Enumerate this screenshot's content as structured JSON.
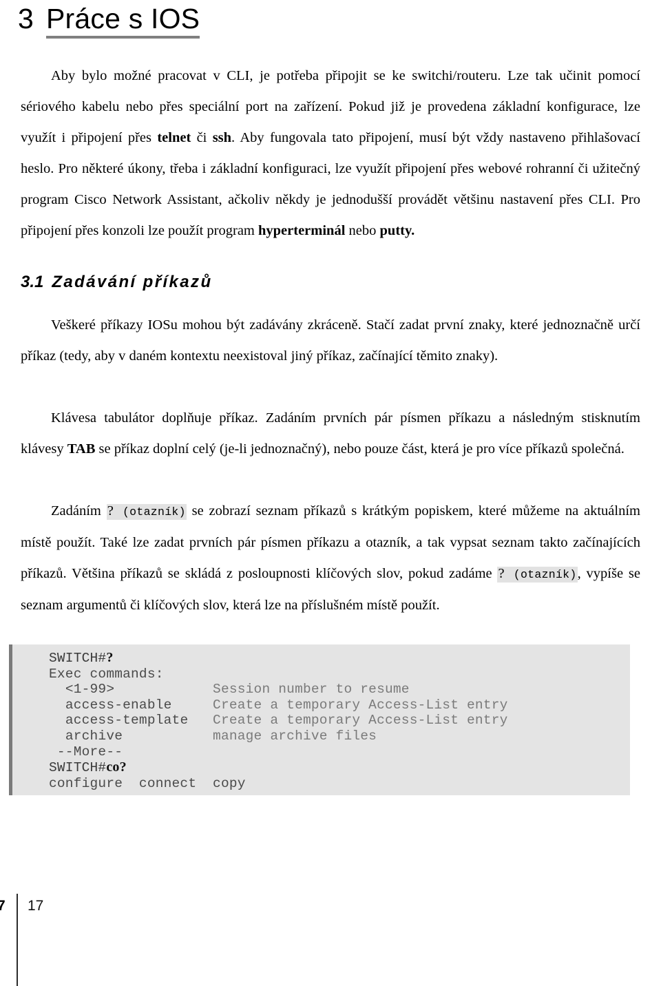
{
  "page": {
    "title_number": "3",
    "title_text": "Práce s IOS",
    "underline_color": "#808080",
    "background_color": "#ffffff"
  },
  "section": {
    "number": "3.1",
    "heading": "Zadávání příkazů"
  },
  "paragraphs": {
    "p1_a": "Aby bylo možné pracovat v CLI, je potřeba připojit se ke switchi/routeru. Lze tak učinit pomocí  sériového kabelu nebo přes speciální port na zařízení. Pokud již je provedena základní konfigurace, lze využít i připojení přes ",
    "p1_bold1": "telnet",
    "p1_b": " či ",
    "p1_bold2": "ssh",
    "p1_c": ". Aby fungovala tato připojení, musí být vždy nastaveno přihlašovací heslo. Pro některé úkony, třeba i základní konfiguraci, lze využít připojení přes webové rohranní či užitečný program Cisco Network Assistant, ačkoliv někdy je jednodušší provádět většinu nastavení přes CLI. Pro připojení přes konzoli lze použít program ",
    "p1_bold3": "hyperterminál",
    "p1_d": " nebo ",
    "p1_bold4": "putty.",
    "p2": "Veškeré příkazy IOSu mohou být zadávány zkráceně. Stačí zadat první znaky, které jednoznačně určí příkaz (tedy, aby v daném kontextu neexistoval jiný příkaz, začínající těmito znaky).",
    "p3_a": "Klávesa tabulátor doplňuje příkaz. Zadáním prvních pár písmen příkazu a následným stisknutím klávesy ",
    "p3_bold": "TAB",
    "p3_b": " se příkaz doplní celý (je-li jednoznačný), nebo pouze část, která je pro více příkazů společná.",
    "p4_a": "Zadáním ",
    "p4_code1_q": "?",
    "p4_code1_t": " (otazník)",
    "p4_b": " se zobrazí seznam příkazů s krátkým popiskem, které můžeme na aktuálním místě použít. Také lze zadat prvních pár písmen příkazu a otazník, a tak vypsat seznam takto začínajících příkazů. Většina příkazů se skládá z posloupnosti klíčových slov, pokud zadáme ",
    "p4_code2_q": "?",
    "p4_code2_t": " (otazník)",
    "p4_c": ", vypíše se seznam argumentů či klíčových slov, která lze na příslušném místě použít."
  },
  "code_block": {
    "background_color": "#e4e4e4",
    "accent_color": "#7a7a7a",
    "lines": [
      {
        "indent": "",
        "prompt": "SWITCH#",
        "bold": "?",
        "cmd": "",
        "desc": ""
      },
      {
        "indent": "",
        "prompt": "",
        "bold": "",
        "cmd": "Exec commands:",
        "desc": ""
      },
      {
        "indent": "  ",
        "prompt": "",
        "bold": "",
        "cmd": "<1-99>",
        "desc": "Session number to resume",
        "pad": 18
      },
      {
        "indent": "  ",
        "prompt": "",
        "bold": "",
        "cmd": "access-enable",
        "desc": "Create a temporary Access-List entry",
        "pad": 18
      },
      {
        "indent": "  ",
        "prompt": "",
        "bold": "",
        "cmd": "access-template",
        "desc": "Create a temporary Access-List entry",
        "pad": 18
      },
      {
        "indent": "  ",
        "prompt": "",
        "bold": "",
        "cmd": "archive",
        "desc": "manage archive files",
        "pad": 18
      },
      {
        "indent": " ",
        "prompt": "",
        "bold": "",
        "cmd": "--More--",
        "desc": ""
      },
      {
        "indent": "",
        "prompt": "SWITCH#",
        "bold": "co?",
        "cmd": "",
        "desc": ""
      },
      {
        "indent": "",
        "prompt": "",
        "bold": "",
        "cmd": "configure  connect  copy",
        "desc": ""
      }
    ]
  },
  "footer": {
    "left_number": "7",
    "right_number": "17"
  }
}
